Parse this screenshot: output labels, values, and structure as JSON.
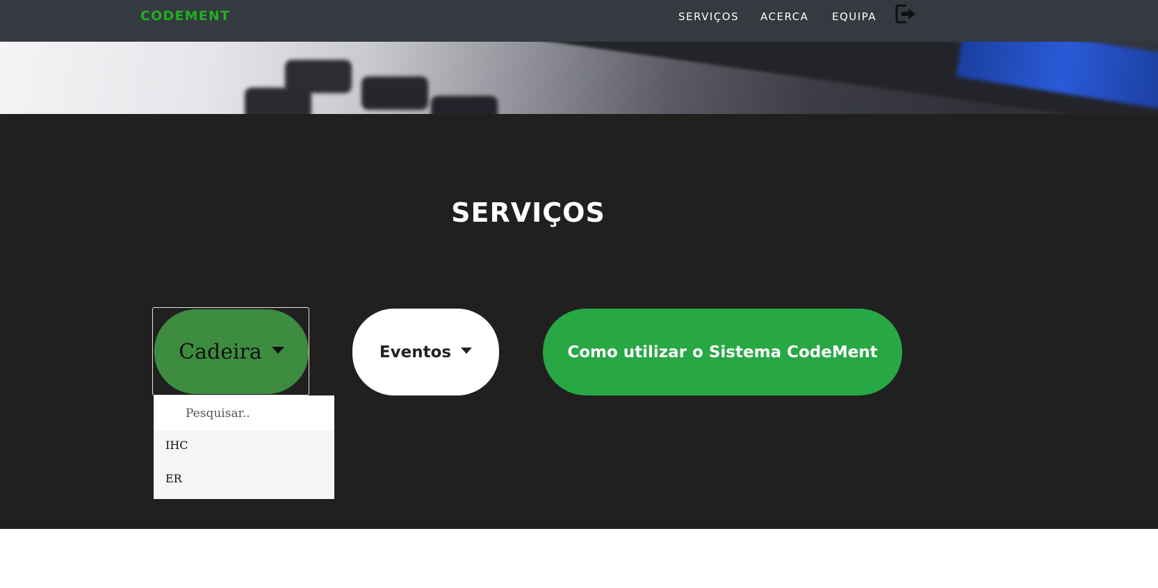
{
  "navbar": {
    "brand": "CODEMENT",
    "links": [
      {
        "label": "SERVIÇOS"
      },
      {
        "label": "ACERCA"
      },
      {
        "label": "EQUIPA"
      }
    ],
    "logout_icon": "logout-icon"
  },
  "services": {
    "title": "SERVIÇOS",
    "cadeira_label": "Cadeira",
    "eventos_label": "Eventos",
    "sistema_label": "Como utilizar o Sistema CodeMent"
  },
  "dropdown": {
    "search_placeholder": "Pesquisar..",
    "items": [
      "IHC",
      "ER"
    ]
  },
  "colors": {
    "brand": "#1fb01f",
    "navbar": "#343a40",
    "section_bg": "#202020",
    "cadeira_button": "#3d8c40",
    "primary_button": "#28a745"
  }
}
